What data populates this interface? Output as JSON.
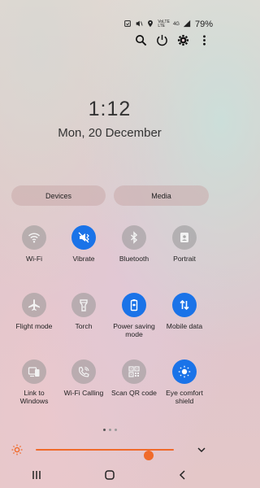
{
  "status_bar": {
    "volte": "VoLTE",
    "lte": "LTE",
    "network_type": "4G",
    "battery": "79%"
  },
  "header": {
    "search_icon": "search-icon",
    "power_icon": "power-icon",
    "settings_icon": "gear-icon",
    "more_icon": "more-vertical-icon"
  },
  "clock": {
    "time": "1:12",
    "date": "Mon, 20 December"
  },
  "segments": {
    "devices_label": "Devices",
    "media_label": "Media"
  },
  "tiles": [
    {
      "label": "Wi-Fi",
      "icon": "wifi-icon",
      "active": false
    },
    {
      "label": "Vibrate",
      "icon": "vibrate-icon",
      "active": true
    },
    {
      "label": "Bluetooth",
      "icon": "bluetooth-icon",
      "active": false
    },
    {
      "label": "Portrait",
      "icon": "portrait-icon",
      "active": false
    },
    {
      "label": "Flight mode",
      "icon": "airplane-icon",
      "active": false
    },
    {
      "label": "Torch",
      "icon": "torch-icon",
      "active": false
    },
    {
      "label": "Power saving mode",
      "icon": "power-saving-icon",
      "active": true
    },
    {
      "label": "Mobile data",
      "icon": "mobile-data-icon",
      "active": true
    },
    {
      "label": "Link to Windows",
      "icon": "link-to-windows-icon",
      "active": false
    },
    {
      "label": "Wi-Fi Calling",
      "icon": "wifi-calling-icon",
      "active": false
    },
    {
      "label": "Scan QR code",
      "icon": "qr-code-icon",
      "active": false
    },
    {
      "label": "Eye comfort shield",
      "icon": "eye-comfort-icon",
      "active": true
    }
  ],
  "page_indicator": {
    "pages": 3,
    "current": 1
  },
  "brightness": {
    "level": 0.82
  },
  "colors": {
    "accent": "#1a73e8",
    "brightness": "#f06a2a"
  }
}
